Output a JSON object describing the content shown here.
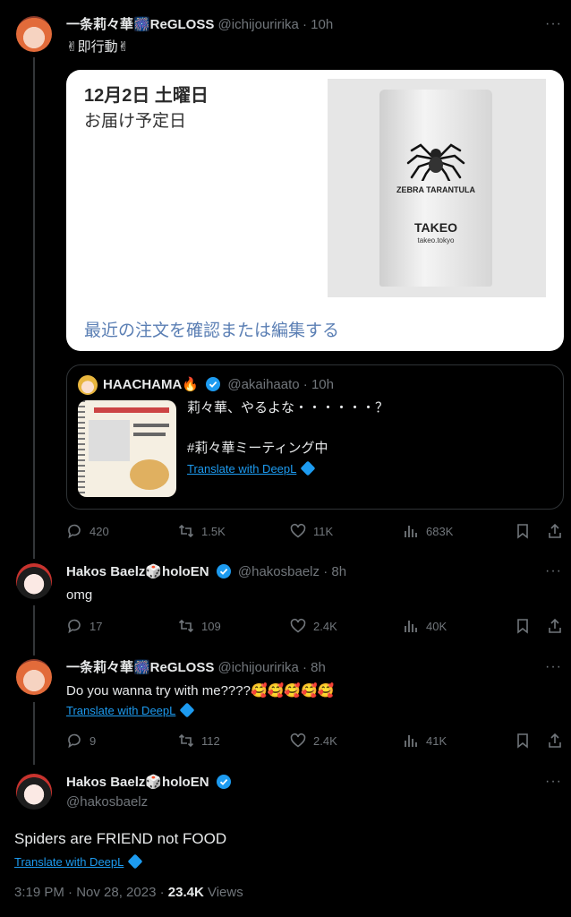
{
  "tweet1": {
    "name": "一条莉々華🎆ReGLOSS",
    "handle": "@ichijouririka",
    "time": "10h",
    "text": "✌即行動✌",
    "card": {
      "date": "12月2日 土曜日",
      "subtitle": "お届け予定日",
      "link": "最近の注文を確認または編集する",
      "product": {
        "title": "ZEBRA TARANTULA",
        "brand": "TAKEO",
        "url": "takeo.tokyo"
      }
    },
    "quote": {
      "name": "HAACHAMA🔥",
      "handle": "@akaihaato",
      "time": "10h",
      "line1": "莉々華、やるよな・・・・・・？",
      "line2": "#莉々華ミーティング中",
      "translate": "Translate with DeepL"
    },
    "stats": {
      "replies": "420",
      "reposts": "1.5K",
      "likes": "11K",
      "views": "683K"
    }
  },
  "tweet2": {
    "name": "Hakos Baelz🎲holoEN",
    "handle": "@hakosbaelz",
    "time": "8h",
    "text": "omg",
    "stats": {
      "replies": "17",
      "reposts": "109",
      "likes": "2.4K",
      "views": "40K"
    }
  },
  "tweet3": {
    "name": "一条莉々華🎆ReGLOSS",
    "handle": "@ichijouririka",
    "time": "8h",
    "text": "Do you wanna try with me????🥰🥰🥰🥰🥰",
    "translate": "Translate with DeepL",
    "stats": {
      "replies": "9",
      "reposts": "112",
      "likes": "2.4K",
      "views": "41K"
    }
  },
  "main": {
    "name": "Hakos Baelz🎲holoEN",
    "handle": "@hakosbaelz",
    "text": "Spiders are FRIEND not FOOD",
    "translate": "Translate with DeepL",
    "timestamp": "3:19 PM · Nov 28, 2023 · ",
    "views_count": "23.4K",
    "views_label": " Views"
  },
  "colors": {
    "background": "#000000",
    "link": "#1d9bf0",
    "muted": "#71767b",
    "verified": "#1d9bf0"
  },
  "icons": [
    "reply-icon",
    "repost-icon",
    "like-icon",
    "views-icon",
    "bookmark-icon",
    "share-icon",
    "more-icon",
    "verified-badge-icon",
    "deepl-icon"
  ]
}
